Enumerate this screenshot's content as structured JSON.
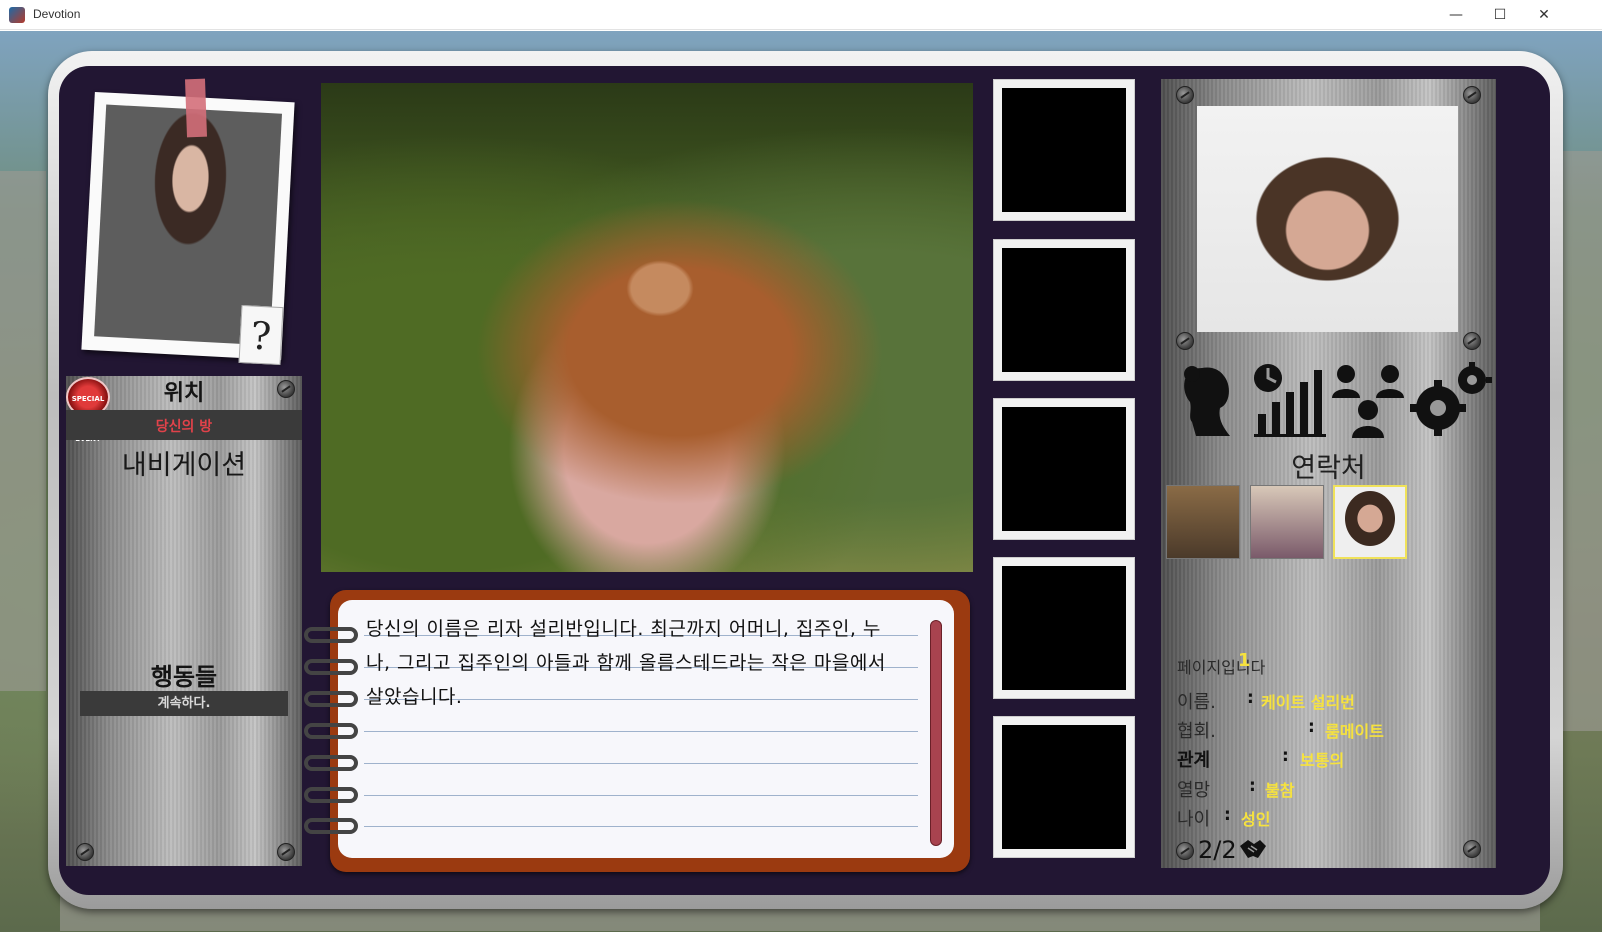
{
  "window": {
    "title": "Devotion",
    "minimize_glyph": "—",
    "maximize_glyph": "☐",
    "close_glyph": "✕"
  },
  "left_panel": {
    "special_badge": "SPECIAL EVENT",
    "location_title": "위치",
    "location_value": "당신의 방",
    "navigation_title": "내비게이션",
    "actions_title": "행동들",
    "action_continue": "계속하다.",
    "question_mark": "?"
  },
  "story": {
    "text": "당신의 이름은 리자 설리반입니다. 최근까지 어머니, 집주인, 누나, 그리고 집주인의 아들과 함께 올름스테드라는 작은 마을에서 살았습니다."
  },
  "right_panel": {
    "contacts_title": "연락처",
    "info": {
      "page_label": "페이지입니다",
      "page_value": "1",
      "name_label": "이름.",
      "name_value": "케이트 설리번",
      "association_label": "협회.",
      "association_value": "룸메이트",
      "relation_label": "관계",
      "relation_value": "보통의",
      "desire_label": "열망",
      "desire_value": "불참",
      "age_label": "나이",
      "age_value": "성인",
      "separator": ":"
    },
    "page_indicator": "2/2"
  },
  "icons": {
    "woman_silhouette": "woman-silhouette-icon",
    "stats": "stats-icon",
    "group": "group-icon",
    "settings": "gear-icon",
    "handshake": "handshake-icon"
  },
  "colors": {
    "frame_bg": "#221633",
    "highlight_yellow": "#f6e23e",
    "location_red": "#e0424a",
    "notebook_brown": "#9b3a10"
  }
}
